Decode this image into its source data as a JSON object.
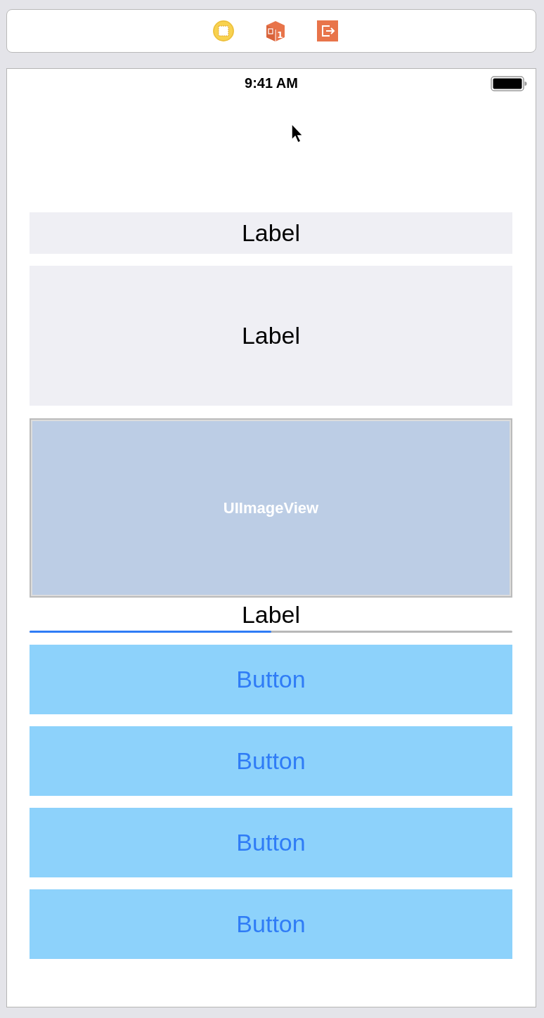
{
  "scene_bar": {
    "cube_badge": "1"
  },
  "status_bar": {
    "time": "9:41 AM"
  },
  "views": [
    {
      "kind": "label",
      "text": "Label"
    },
    {
      "kind": "tall-label",
      "text": "Label"
    },
    {
      "kind": "image",
      "text": "UIImageView"
    },
    {
      "kind": "plain-label",
      "text": "Label"
    },
    {
      "kind": "progress",
      "level": 0.5
    },
    {
      "kind": "button",
      "text": "Button"
    },
    {
      "kind": "button",
      "text": "Button"
    },
    {
      "kind": "button",
      "text": "Button"
    },
    {
      "kind": "button",
      "text": "Button"
    }
  ]
}
